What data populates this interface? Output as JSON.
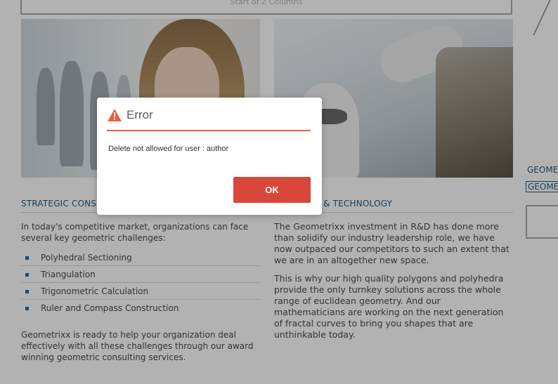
{
  "layout_bar": {
    "label": "Start of 2 Columns"
  },
  "left_column": {
    "heading": "STRATEGIC CONSULTING",
    "intro": "In today's competitive market, organizations can face several key geometric challenges:",
    "bullets": [
      "Polyhedral Sectioning",
      "Triangulation",
      "Trigonometric Calculation",
      "Ruler and Compass Construction"
    ],
    "closing": "Geometrixx is ready to help your organization deal effectively with all these challenges through our award winning geometric consulting services."
  },
  "right_column": {
    "heading": "RESEARCH & TECHNOLOGY",
    "paragraph_1": "The Geometrixx investment in R&D has done more than solidify our industry leadership role, we have now outpaced our competitors to such an extent that we are in an altogether new space.",
    "paragraph_2": "This is why our high quality polygons and polyhedra provide the only turnkey solutions across the whole range of euclidean geometry. And our mathematicians are working on the next generation of fractal curves to bring you shapes that are unthinkable today."
  },
  "sidebar": {
    "link_1": "GEOMETRIXX",
    "link_2": "GEOMETRIXX"
  },
  "dialog": {
    "title": "Error",
    "message": "Delete not allowed for user : author",
    "ok_label": "OK",
    "icon": "warning-icon",
    "accent_color": "#e9603f",
    "button_color": "#d9473b"
  }
}
